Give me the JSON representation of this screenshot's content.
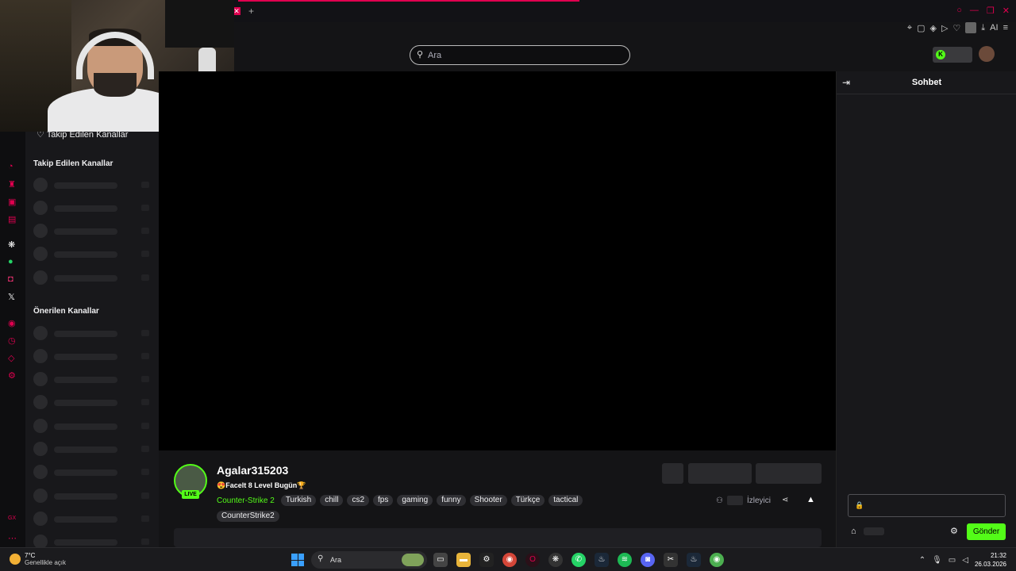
{
  "browser": {
    "close_tab": "✕",
    "new_tab": "+",
    "ai_label": "AI"
  },
  "search": {
    "placeholder": "Ara"
  },
  "sidebar": {
    "header": "Takip Edilen Kanallar",
    "followed_title": "Takip Edilen Kanallar",
    "recommended_title": "Önerilen Kanallar",
    "gx_label": "GX"
  },
  "channel": {
    "name": "Agalar315203",
    "title": "😍Facelt 8 Level Bugün🏆",
    "live_badge": "LIVE",
    "category": "Counter-Strike 2",
    "tags": [
      "Turkish",
      "chill",
      "cs2",
      "fps",
      "gaming",
      "funny",
      "Shooter",
      "Türkçe",
      "tactical",
      "CounterStrike2"
    ],
    "viewers_label": "İzleyici"
  },
  "chat": {
    "title": "Sohbet",
    "send_label": "Gönder"
  },
  "taskbar": {
    "temp": "7°C",
    "weather": "Genellikle açık",
    "search_text": "Ara",
    "time": "21:32",
    "date": "26.03.2026"
  },
  "colors": {
    "accent": "#53fc18",
    "brand_pink": "#e0004f"
  }
}
